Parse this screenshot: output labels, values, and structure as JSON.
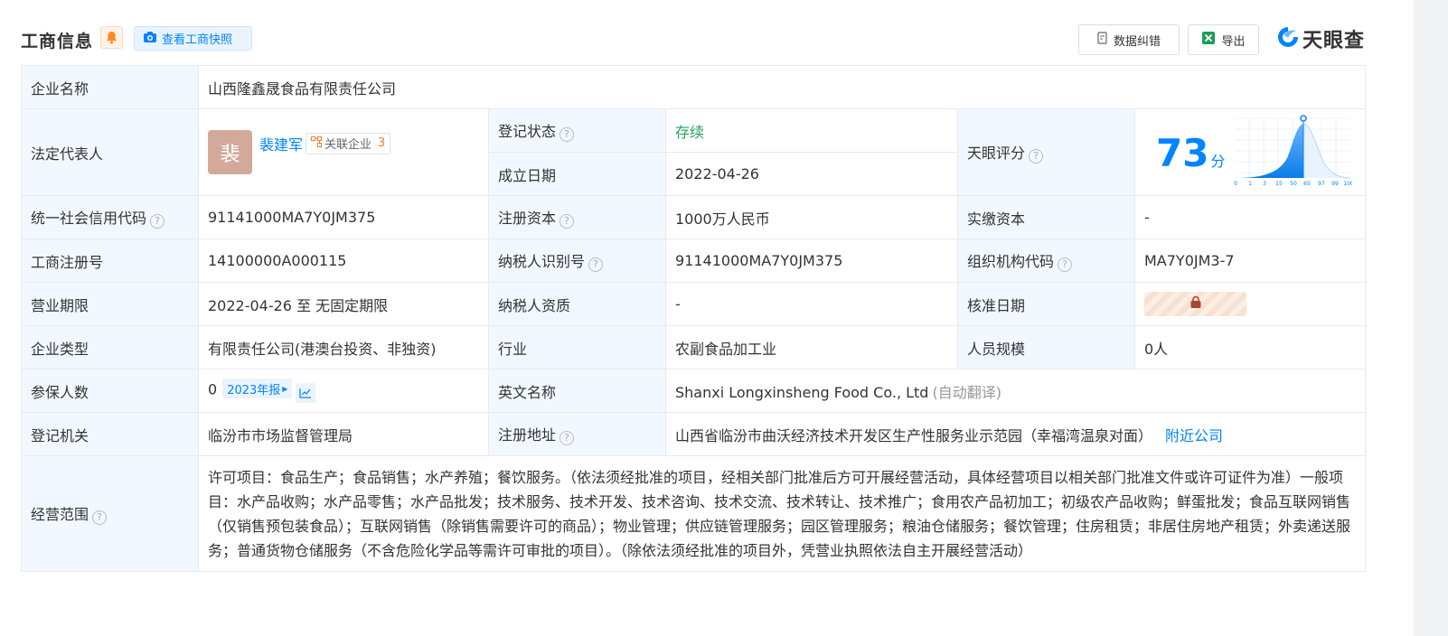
{
  "header": {
    "title": "工商信息",
    "snapshot_label": "查看工商快照",
    "correct_label": "数据纠错",
    "export_label": "导出",
    "logo_text": "天眼查"
  },
  "company": {
    "name_label": "企业名称",
    "name": "山西隆鑫晟食品有限责任公司",
    "rep_label": "法定代表人",
    "rep_avatar_char": "裴",
    "rep_name": "裴建军",
    "rel_label": "关联企业",
    "rel_count": "3",
    "status_label": "登记状态",
    "status": "存续",
    "founded_label": "成立日期",
    "founded": "2022-04-26",
    "score_label": "天眼评分",
    "score": "73",
    "score_unit": "分",
    "credit_label": "统一社会信用代码",
    "credit": "91141000MA7Y0JM375",
    "reg_capital_label": "注册资本",
    "reg_capital": "1000万人民币",
    "paid_capital_label": "实缴资本",
    "paid_capital": "-",
    "reg_no_label": "工商注册号",
    "reg_no": "14100000A000115",
    "taxpayer_id_label": "纳税人识别号",
    "taxpayer_id": "91141000MA7Y0JM375",
    "org_code_label": "组织机构代码",
    "org_code": "MA7Y0JM3-7",
    "term_label": "营业期限",
    "term": "2022-04-26 至 无固定期限",
    "taxpayer_qual_label": "纳税人资质",
    "taxpayer_qual": "-",
    "approve_label": "核准日期",
    "type_label": "企业类型",
    "type": "有限责任公司(港澳台投资、非独资)",
    "industry_label": "行业",
    "industry": "农副食品加工业",
    "staff_label": "人员规模",
    "staff": "0人",
    "insured_label": "参保人数",
    "insured": "0",
    "insured_year": "2023年报",
    "english_label": "英文名称",
    "english": "Shanxi Longxinsheng Food Co., Ltd",
    "english_note": "(自动翻译)",
    "authority_label": "登记机关",
    "authority": "临汾市市场监督管理局",
    "address_label": "注册地址",
    "address": "山西省临汾市曲沃经济技术开发区生产性服务业示范园（幸福湾温泉对面）",
    "nearby_label": "附近公司",
    "scope_label": "经营范围",
    "scope": "许可项目：食品生产；食品销售；水产养殖；餐饮服务。（依法须经批准的项目，经相关部门批准后方可开展经营活动，具体经营项目以相关部门批准文件或许可证件为准）一般项目：水产品收购；水产品零售；水产品批发；技术服务、技术开发、技术咨询、技术交流、技术转让、技术推广；食用农产品初加工；初级农产品收购；鲜蛋批发；食品互联网销售（仅销售预包装食品）；互联网销售（除销售需要许可的商品）；物业管理；供应链管理服务；园区管理服务；粮油仓储服务；餐饮管理；住房租赁；非居住房地产租赁；外卖递送服务；普通货物仓储服务（不含危险化学品等需许可审批的项目）。（除依法须经批准的项目外，凭营业执照依法自主开展经营活动）"
  },
  "score_chart": {
    "ticks": [
      "0",
      "1",
      "3",
      "15",
      "50",
      "65",
      "97",
      "99",
      "100"
    ]
  },
  "colors": {
    "accent": "#0084ff",
    "label_bg": "#f2f8ff",
    "status_green": "#1fa35b",
    "rel_count": "#ff7b2c"
  }
}
